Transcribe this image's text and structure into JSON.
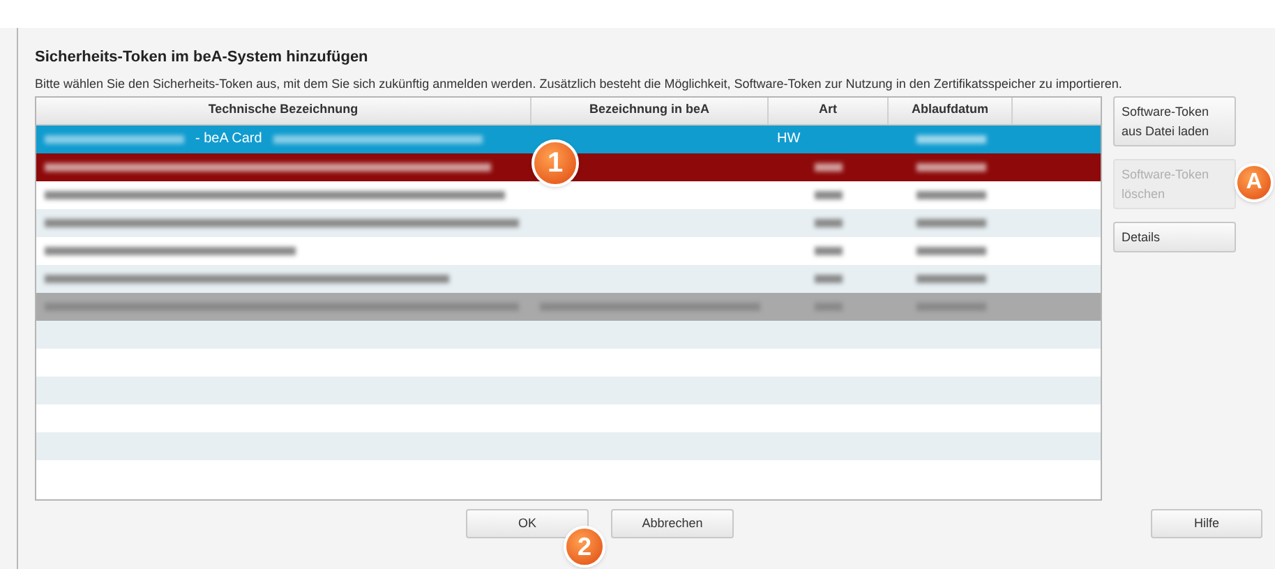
{
  "dialog": {
    "title": "Sicherheits-Token im beA-System hinzufügen",
    "description": "Bitte wählen Sie den Sicherheits-Token aus, mit dem Sie sich zukünftig anmelden werden. Zusätzlich besteht die Möglichkeit, Software-Token zur Nutzung in den Zertifikatsspeicher zu importieren."
  },
  "table": {
    "columns": [
      "Technische Bezeichnung",
      "Bezeichnung in beA",
      "Art",
      "Ablaufdatum"
    ],
    "rows": [
      {
        "selected": true,
        "cells": [
          {
            "kind": "mixed",
            "text": "- beA Card"
          },
          {
            "kind": "empty"
          },
          {
            "kind": "text",
            "text": "HW"
          },
          {
            "kind": "redacted"
          }
        ]
      },
      {
        "selected": false,
        "kind": "expired",
        "cells": [
          {
            "kind": "redacted"
          },
          {
            "kind": "empty"
          },
          {
            "kind": "redacted"
          },
          {
            "kind": "redacted"
          }
        ]
      },
      {
        "selected": false,
        "kind": "ok",
        "cells": [
          {
            "kind": "redacted"
          },
          {
            "kind": "empty"
          },
          {
            "kind": "redacted"
          },
          {
            "kind": "redacted"
          }
        ]
      },
      {
        "selected": false,
        "kind": "ok",
        "cells": [
          {
            "kind": "redacted"
          },
          {
            "kind": "empty"
          },
          {
            "kind": "redacted"
          },
          {
            "kind": "redacted"
          }
        ]
      },
      {
        "selected": false,
        "kind": "ok",
        "cells": [
          {
            "kind": "redacted"
          },
          {
            "kind": "empty"
          },
          {
            "kind": "redacted"
          },
          {
            "kind": "redacted"
          }
        ]
      },
      {
        "selected": false,
        "kind": "ok",
        "cells": [
          {
            "kind": "redacted"
          },
          {
            "kind": "empty"
          },
          {
            "kind": "redacted"
          },
          {
            "kind": "redacted"
          }
        ]
      },
      {
        "selected": false,
        "kind": "inactive",
        "cells": [
          {
            "kind": "redacted"
          },
          {
            "kind": "redacted"
          },
          {
            "kind": "redacted"
          },
          {
            "kind": "redacted"
          }
        ]
      }
    ]
  },
  "side_buttons": [
    {
      "label": "Software-Token aus Datei laden",
      "disabled": false
    },
    {
      "label": "Software-Token löschen",
      "disabled": true
    },
    {
      "label": "Details",
      "disabled": false
    }
  ],
  "footer_buttons": [
    {
      "label": "OK"
    },
    {
      "label": "Abbrechen"
    }
  ],
  "help_button": {
    "label": "Hilfe"
  },
  "markers": [
    {
      "label": "1"
    },
    {
      "label": "2"
    },
    {
      "label": "A"
    }
  ]
}
